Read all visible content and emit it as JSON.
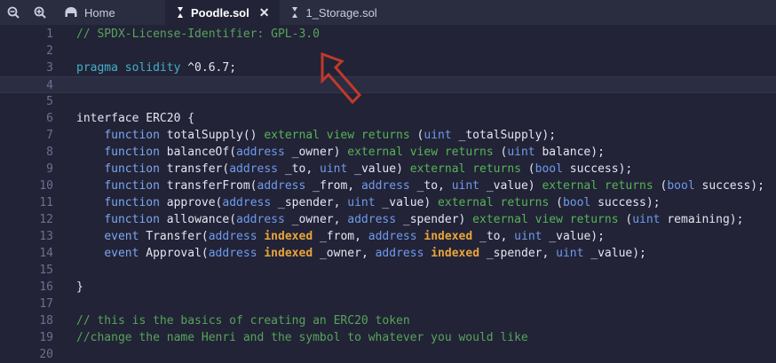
{
  "toolbar": {
    "zoom_out_icon": "zoom-out-icon",
    "zoom_in_icon": "zoom-in-icon"
  },
  "tabs": [
    {
      "label": "Home",
      "icon": "remix-logo-icon",
      "active": false
    },
    {
      "label": "Poodle.sol",
      "icon": "solidity-icon",
      "active": true,
      "closable": true
    },
    {
      "label": "1_Storage.sol",
      "icon": "solidity-icon",
      "active": false
    }
  ],
  "colors": {
    "background": "#222336",
    "comment": "#56a45a",
    "keyword": "#44b0c8",
    "type": "#6f9bee",
    "indexed": "#e7a43c",
    "annotation_arrow": "#c0392b"
  },
  "current_line": 4,
  "lines": [
    {
      "n": "1",
      "tokens": [
        {
          "t": "// SPDX-License-Identifier: GPL-3.0",
          "c": "comment"
        }
      ]
    },
    {
      "n": "2",
      "tokens": []
    },
    {
      "n": "3",
      "tokens": [
        {
          "t": "pragma solidity",
          "c": "kw"
        },
        {
          "t": " ^0.6.7;",
          "c": "text"
        }
      ]
    },
    {
      "n": "4",
      "tokens": []
    },
    {
      "n": "5",
      "tokens": []
    },
    {
      "n": "6",
      "tokens": [
        {
          "t": "interface ERC20 {",
          "c": "text"
        }
      ]
    },
    {
      "n": "7",
      "tokens": [
        {
          "t": "    "
        },
        {
          "t": "function",
          "c": "bluekw"
        },
        {
          "t": " totalSupply() ",
          "c": "text"
        },
        {
          "t": "external view returns",
          "c": "green"
        },
        {
          "t": " (",
          "c": "text"
        },
        {
          "t": "uint",
          "c": "type"
        },
        {
          "t": " _totalSupply);",
          "c": "text"
        }
      ]
    },
    {
      "n": "8",
      "tokens": [
        {
          "t": "    "
        },
        {
          "t": "function",
          "c": "bluekw"
        },
        {
          "t": " balanceOf(",
          "c": "text"
        },
        {
          "t": "address",
          "c": "type"
        },
        {
          "t": " _owner) ",
          "c": "text"
        },
        {
          "t": "external view returns",
          "c": "green"
        },
        {
          "t": " (",
          "c": "text"
        },
        {
          "t": "uint",
          "c": "type"
        },
        {
          "t": " balance);",
          "c": "text"
        }
      ]
    },
    {
      "n": "9",
      "tokens": [
        {
          "t": "    "
        },
        {
          "t": "function",
          "c": "bluekw"
        },
        {
          "t": " transfer(",
          "c": "text"
        },
        {
          "t": "address",
          "c": "type"
        },
        {
          "t": " _to, ",
          "c": "text"
        },
        {
          "t": "uint",
          "c": "type"
        },
        {
          "t": " _value) ",
          "c": "text"
        },
        {
          "t": "external returns",
          "c": "green"
        },
        {
          "t": " (",
          "c": "text"
        },
        {
          "t": "bool",
          "c": "type"
        },
        {
          "t": " success);",
          "c": "text"
        }
      ]
    },
    {
      "n": "10",
      "tokens": [
        {
          "t": "    "
        },
        {
          "t": "function",
          "c": "bluekw"
        },
        {
          "t": " transferFrom(",
          "c": "text"
        },
        {
          "t": "address",
          "c": "type"
        },
        {
          "t": " _from, ",
          "c": "text"
        },
        {
          "t": "address",
          "c": "type"
        },
        {
          "t": " _to, ",
          "c": "text"
        },
        {
          "t": "uint",
          "c": "type"
        },
        {
          "t": " _value) ",
          "c": "text"
        },
        {
          "t": "external returns",
          "c": "green"
        },
        {
          "t": " (",
          "c": "text"
        },
        {
          "t": "bool",
          "c": "type"
        },
        {
          "t": " success);",
          "c": "text"
        }
      ]
    },
    {
      "n": "11",
      "tokens": [
        {
          "t": "    "
        },
        {
          "t": "function",
          "c": "bluekw"
        },
        {
          "t": " approve(",
          "c": "text"
        },
        {
          "t": "address",
          "c": "type"
        },
        {
          "t": " _spender, ",
          "c": "text"
        },
        {
          "t": "uint",
          "c": "type"
        },
        {
          "t": " _value) ",
          "c": "text"
        },
        {
          "t": "external returns",
          "c": "green"
        },
        {
          "t": " (",
          "c": "text"
        },
        {
          "t": "bool",
          "c": "type"
        },
        {
          "t": " success);",
          "c": "text"
        }
      ]
    },
    {
      "n": "12",
      "tokens": [
        {
          "t": "    "
        },
        {
          "t": "function",
          "c": "bluekw"
        },
        {
          "t": " allowance(",
          "c": "text"
        },
        {
          "t": "address",
          "c": "type"
        },
        {
          "t": " _owner, ",
          "c": "text"
        },
        {
          "t": "address",
          "c": "type"
        },
        {
          "t": " _spender) ",
          "c": "text"
        },
        {
          "t": "external view returns",
          "c": "green"
        },
        {
          "t": " (",
          "c": "text"
        },
        {
          "t": "uint",
          "c": "type"
        },
        {
          "t": " remaining);",
          "c": "text"
        }
      ]
    },
    {
      "n": "13",
      "tokens": [
        {
          "t": "    "
        },
        {
          "t": "event",
          "c": "bluekw"
        },
        {
          "t": " Transfer(",
          "c": "text"
        },
        {
          "t": "address",
          "c": "type"
        },
        {
          "t": " "
        },
        {
          "t": "indexed",
          "c": "idx"
        },
        {
          "t": " _from, ",
          "c": "text"
        },
        {
          "t": "address",
          "c": "type"
        },
        {
          "t": " "
        },
        {
          "t": "indexed",
          "c": "idx"
        },
        {
          "t": " _to, ",
          "c": "text"
        },
        {
          "t": "uint",
          "c": "type"
        },
        {
          "t": " _value);",
          "c": "text"
        }
      ]
    },
    {
      "n": "14",
      "tokens": [
        {
          "t": "    "
        },
        {
          "t": "event",
          "c": "bluekw"
        },
        {
          "t": " Approval(",
          "c": "text"
        },
        {
          "t": "address",
          "c": "type"
        },
        {
          "t": " "
        },
        {
          "t": "indexed",
          "c": "idx"
        },
        {
          "t": " _owner, ",
          "c": "text"
        },
        {
          "t": "address",
          "c": "type"
        },
        {
          "t": " "
        },
        {
          "t": "indexed",
          "c": "idx"
        },
        {
          "t": " _spender, ",
          "c": "text"
        },
        {
          "t": "uint",
          "c": "type"
        },
        {
          "t": " _value);",
          "c": "text"
        }
      ]
    },
    {
      "n": "15",
      "tokens": []
    },
    {
      "n": "16",
      "tokens": [
        {
          "t": "}",
          "c": "text"
        }
      ]
    },
    {
      "n": "17",
      "tokens": []
    },
    {
      "n": "18",
      "tokens": [
        {
          "t": "// this is the basics of creating an ERC20 token",
          "c": "comment"
        }
      ]
    },
    {
      "n": "19",
      "tokens": [
        {
          "t": "//change the name Henri and the symbol to whatever you would like",
          "c": "comment"
        }
      ]
    },
    {
      "n": "20",
      "tokens": []
    }
  ]
}
